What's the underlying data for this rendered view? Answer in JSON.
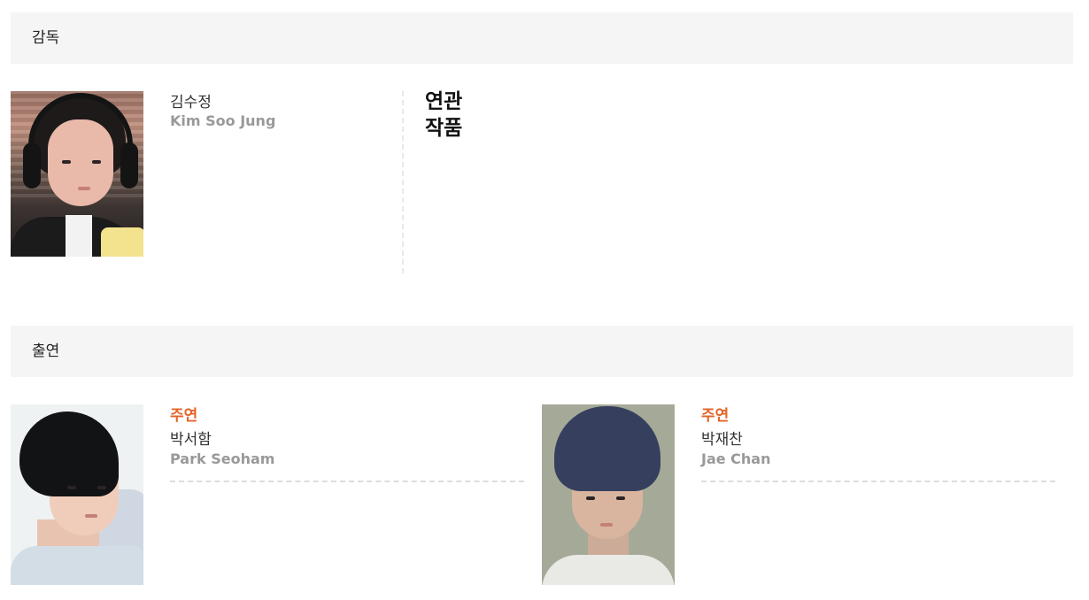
{
  "sections": {
    "director": {
      "title": "감독",
      "person": {
        "name_ko": "김수정",
        "name_en": "Kim Soo Jung"
      },
      "related_works_title": "연관\n작품"
    },
    "cast": {
      "title": "출연",
      "members": [
        {
          "role": "주연",
          "name_ko": "박서함",
          "name_en": "Park Seoham"
        },
        {
          "role": "주연",
          "name_ko": "박재찬",
          "name_en": "Jae Chan"
        }
      ]
    }
  },
  "colors": {
    "section_bar_bg": "#f5f5f5",
    "role_accent": "#e5642a",
    "english_name": "#999999",
    "divider": "#dcdcdc"
  }
}
